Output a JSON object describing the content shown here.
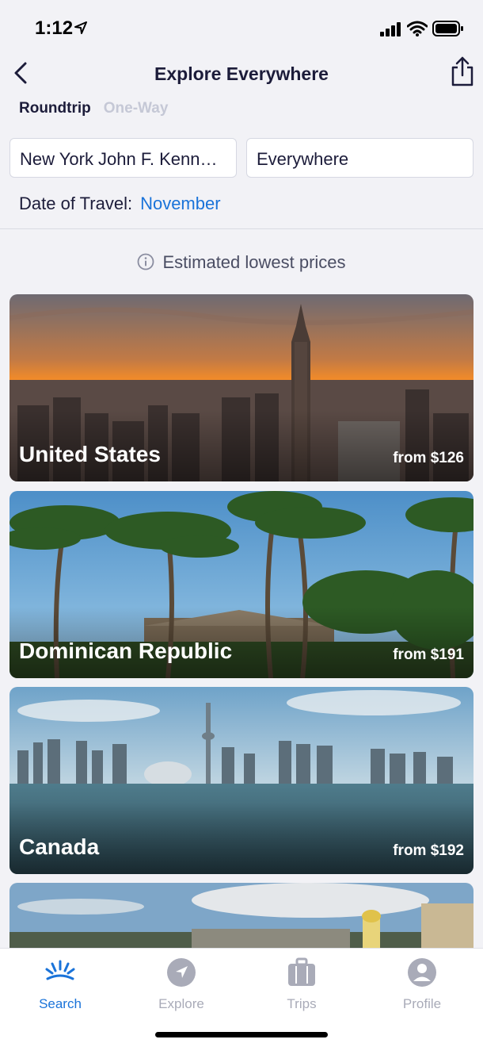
{
  "status_bar": {
    "time": "1:12"
  },
  "header": {
    "title": "Explore Everywhere"
  },
  "trip_type": {
    "selected": "Roundtrip",
    "other": "One-Way"
  },
  "search": {
    "origin": "New York John F. Kennedy",
    "destination": "Everywhere"
  },
  "date": {
    "label": "Date of Travel:",
    "value": "November"
  },
  "estimate_note": "Estimated lowest prices",
  "destinations": [
    {
      "name": "United States",
      "price": "from $126"
    },
    {
      "name": "Dominican Republic",
      "price": "from $191"
    },
    {
      "name": "Canada",
      "price": "from $192"
    }
  ],
  "tabs": [
    {
      "label": "Search",
      "icon": "sunrise-icon",
      "active": true
    },
    {
      "label": "Explore",
      "icon": "compass-icon",
      "active": false
    },
    {
      "label": "Trips",
      "icon": "suitcase-icon",
      "active": false
    },
    {
      "label": "Profile",
      "icon": "person-icon",
      "active": false
    }
  ],
  "colors": {
    "accent": "#1a73d9",
    "title": "#1c1c3a",
    "inactive": "#a9abb8"
  }
}
